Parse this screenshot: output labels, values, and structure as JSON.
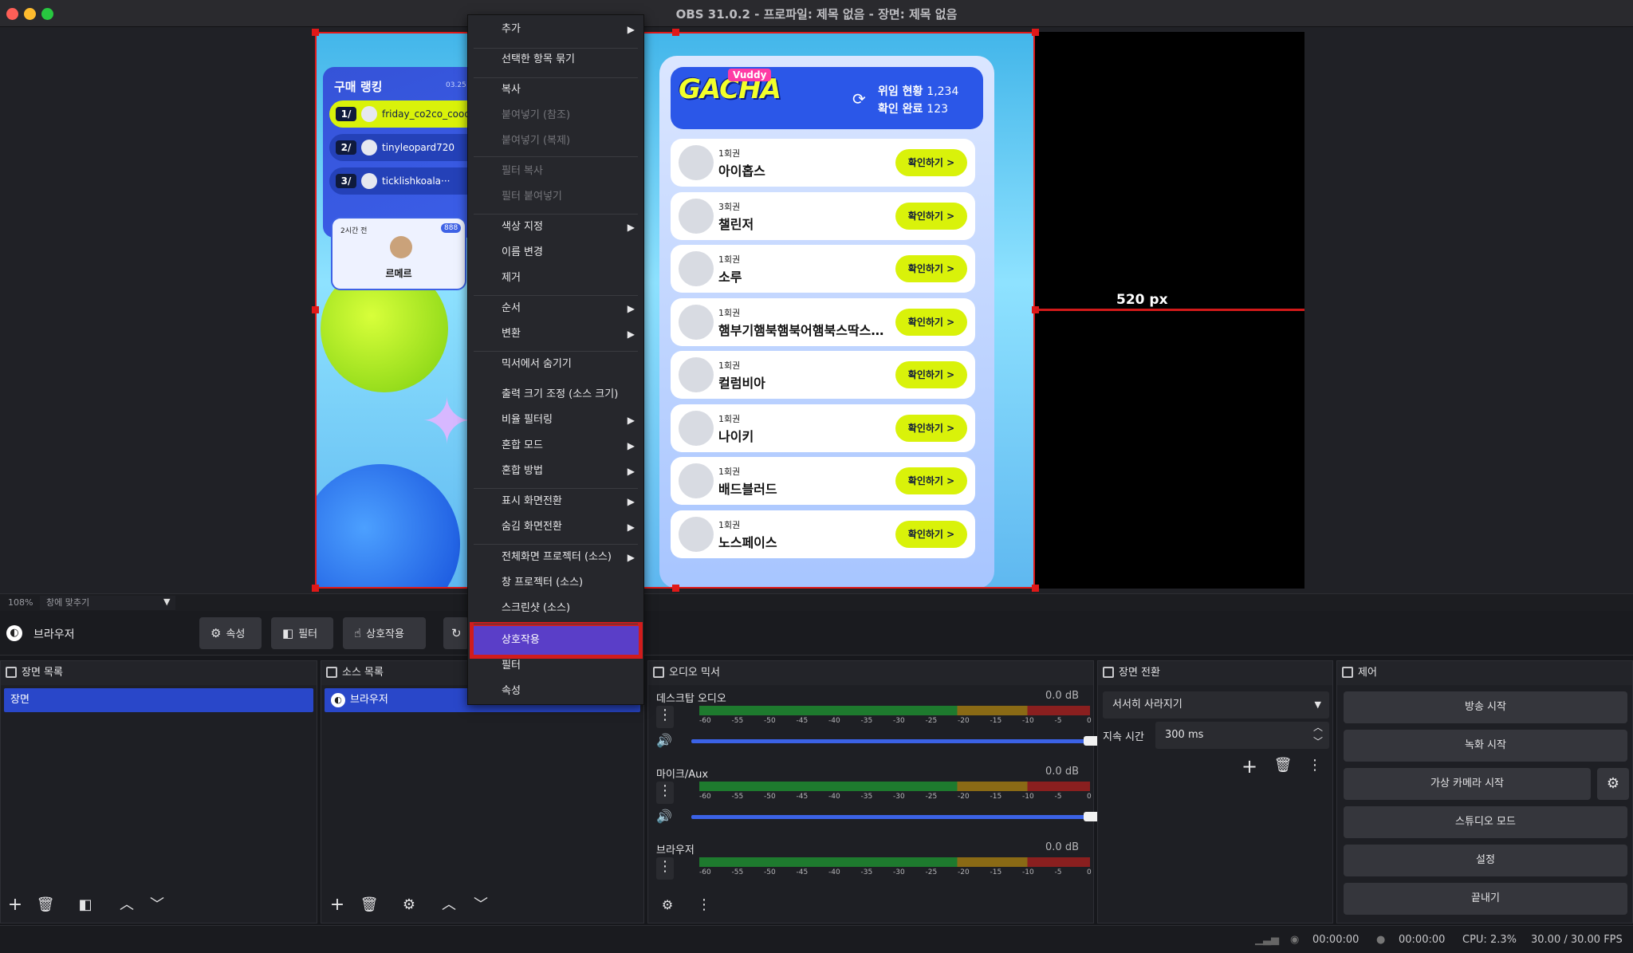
{
  "window": {
    "title": "OBS 31.0.2 - 프로파일: 제목 없음 - 장면: 제목 없음"
  },
  "preview": {
    "width_label": "520 px",
    "ranking": {
      "title": "구매 랭킹",
      "date": "03.25 1",
      "rows": [
        {
          "rank": "1/",
          "name": "friday_co2co_cooo"
        },
        {
          "rank": "2/",
          "name": "tinyleopard720"
        },
        {
          "rank": "3/",
          "name": "ticklishkoala···"
        }
      ],
      "card": {
        "time": "2시간 전",
        "badge": "888",
        "name": "르메르"
      }
    },
    "gacha": {
      "logo_tag": "Vuddy",
      "logo": "GACHA",
      "stat1_label": "위임 현황",
      "stat1_value": "1,234",
      "stat2_label": "확인 완료",
      "stat2_value": "123",
      "items": [
        {
          "count": "1회권",
          "name": "아이홉스",
          "button": "확인하기 >"
        },
        {
          "count": "3회권",
          "name": "챌린저",
          "button": "확인하기 >"
        },
        {
          "count": "1회권",
          "name": "소루",
          "button": "확인하기 >"
        },
        {
          "count": "1회권",
          "name": "햄부기햄북햄북어햄북스딱스함부···",
          "button": "확인하기 >"
        },
        {
          "count": "1회권",
          "name": "컬럼비아",
          "button": "확인하기 >"
        },
        {
          "count": "1회권",
          "name": "나이키",
          "button": "확인하기 >"
        },
        {
          "count": "1회권",
          "name": "배드블러드",
          "button": "확인하기 >"
        },
        {
          "count": "1회권",
          "name": "노스페이스",
          "button": "확인하기 >"
        }
      ]
    },
    "zoom": "108%",
    "fit": "창에 맞추기"
  },
  "context_menu": {
    "items": [
      {
        "label": "추가",
        "submenu": true,
        "disabled": false
      },
      {
        "label": "선택한 항목 묶기",
        "submenu": false,
        "disabled": false
      },
      {
        "label": "복사",
        "submenu": false,
        "disabled": false
      },
      {
        "label": "붙여넣기 (참조)",
        "submenu": false,
        "disabled": true
      },
      {
        "label": "붙여넣기 (복제)",
        "submenu": false,
        "disabled": true
      },
      {
        "label": "필터 복사",
        "submenu": false,
        "disabled": true
      },
      {
        "label": "필터 붙여넣기",
        "submenu": false,
        "disabled": true
      },
      {
        "label": "색상 지정",
        "submenu": true,
        "disabled": false
      },
      {
        "label": "이름 변경",
        "submenu": false,
        "disabled": false
      },
      {
        "label": "제거",
        "submenu": false,
        "disabled": false
      },
      {
        "label": "순서",
        "submenu": true,
        "disabled": false
      },
      {
        "label": "변환",
        "submenu": true,
        "disabled": false
      },
      {
        "label": "믹서에서 숨기기",
        "submenu": false,
        "disabled": false
      },
      {
        "label": "출력 크기 조정 (소스 크기)",
        "submenu": false,
        "disabled": false
      },
      {
        "label": "비율 필터링",
        "submenu": true,
        "disabled": false
      },
      {
        "label": "혼합 모드",
        "submenu": true,
        "disabled": false
      },
      {
        "label": "혼합 방법",
        "submenu": true,
        "disabled": false
      },
      {
        "label": "표시 화면전환",
        "submenu": true,
        "disabled": false
      },
      {
        "label": "숨김 화면전환",
        "submenu": true,
        "disabled": false
      },
      {
        "label": "전체화면 프로젝터 (소스)",
        "submenu": true,
        "disabled": false
      },
      {
        "label": "창 프로젝터 (소스)",
        "submenu": false,
        "disabled": false
      },
      {
        "label": "스크린샷 (소스)",
        "submenu": false,
        "disabled": false
      },
      {
        "label": "상호작용",
        "submenu": false,
        "disabled": false,
        "highlighted": true
      },
      {
        "label": "필터",
        "submenu": false,
        "disabled": false
      },
      {
        "label": "속성",
        "submenu": false,
        "disabled": false
      }
    ]
  },
  "toolbar": {
    "selected_source": "브라우저",
    "properties": "속성",
    "filters": "필터",
    "interact": "상호작용"
  },
  "scenes": {
    "title": "장면 목록",
    "items": [
      "장면"
    ]
  },
  "sources": {
    "title": "소스 목록",
    "items": [
      "브라우저"
    ]
  },
  "mixer": {
    "title": "오디오 믹서",
    "channels": [
      {
        "name": "데스크탑 오디오",
        "db": "0.0 dB"
      },
      {
        "name": "마이크/Aux",
        "db": "0.0 dB"
      },
      {
        "name": "브라우저",
        "db": "0.0 dB"
      }
    ],
    "scale": [
      "-60",
      "-55",
      "-50",
      "-45",
      "-40",
      "-35",
      "-30",
      "-25",
      "-20",
      "-15",
      "-10",
      "-5",
      "0"
    ]
  },
  "transitions": {
    "title": "장면 전환",
    "type": "서서히 사라지기",
    "duration_label": "지속 시간",
    "duration": "300 ms"
  },
  "controls": {
    "title": "제어",
    "buttons": [
      "방송 시작",
      "녹화 시작",
      "가상 카메라 시작",
      "스튜디오 모드",
      "설정",
      "끝내기"
    ]
  },
  "status": {
    "stream_time": "00:00:00",
    "rec_time": "00:00:00",
    "cpu": "CPU: 2.3%",
    "fps": "30.00 / 30.00 FPS"
  }
}
